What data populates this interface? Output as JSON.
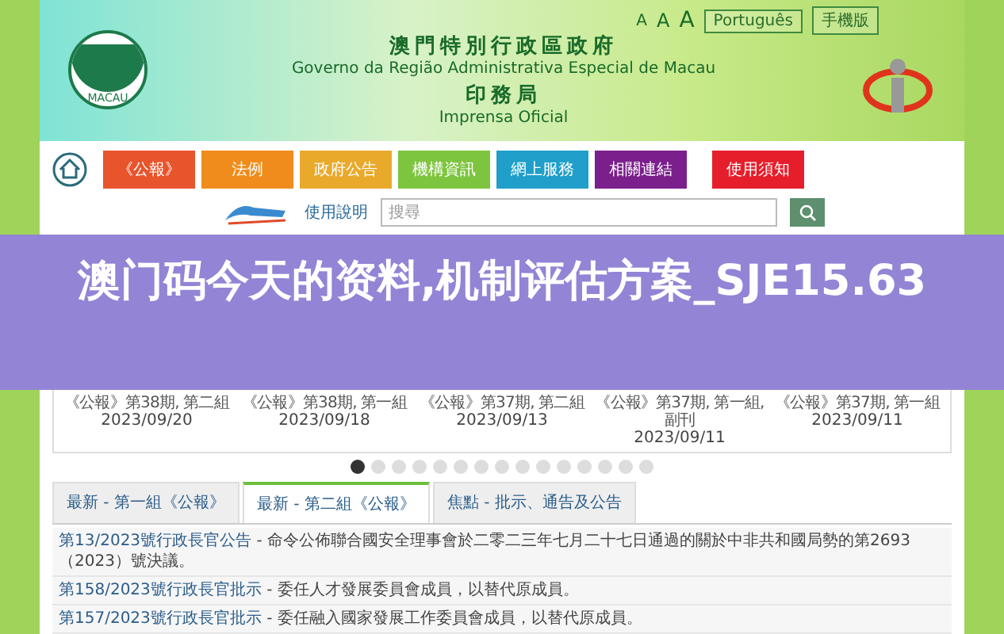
{
  "header": {
    "font_sizes": [
      "A",
      "A",
      "A"
    ],
    "languages": [
      "Português",
      "手機版"
    ],
    "title_zh": "澳門特別行政區政府",
    "title_pt": "Governo da Região Administrativa Especial de Macau",
    "dept_zh": "印務局",
    "dept_pt": "Imprensa Oficial",
    "emblem_text": "MACAU"
  },
  "nav": [
    {
      "label": "《公報》",
      "color": "#e8542c"
    },
    {
      "label": "法例",
      "color": "#f08c1c"
    },
    {
      "label": "政府公告",
      "color": "#e9aa2c"
    },
    {
      "label": "機構資訊",
      "color": "#7dc53e"
    },
    {
      "label": "網上服務",
      "color": "#1f9fc9"
    },
    {
      "label": "相關連結",
      "color": "#7b1f8c"
    },
    {
      "label": "使用須知",
      "color": "#e61e2b"
    }
  ],
  "search": {
    "help": "使用說明",
    "placeholder": "搜尋"
  },
  "banner": {
    "title": "澳门码今天的资料,机制评估方案_SJE15.63"
  },
  "cards": [
    {
      "caption": "《公報》第38期, 第二組",
      "date": "2023/09/20"
    },
    {
      "caption": "《公報》第38期, 第一組",
      "date": "2023/09/18"
    },
    {
      "caption": "《公報》第37期, 第二組",
      "date": "2023/09/13"
    },
    {
      "caption": "《公報》第37期, 第一組, 副刊",
      "date": "2023/09/11"
    },
    {
      "caption": "《公報》第37期, 第一組",
      "date": "2023/09/11"
    }
  ],
  "dots": [
    {
      "selected": true
    },
    {
      "selected": false
    },
    {
      "selected": false
    },
    {
      "selected": false
    },
    {
      "selected": false
    },
    {
      "selected": false
    },
    {
      "selected": false
    },
    {
      "selected": false
    },
    {
      "selected": false
    },
    {
      "selected": false
    },
    {
      "selected": false
    },
    {
      "selected": false
    },
    {
      "selected": false
    },
    {
      "selected": false
    },
    {
      "selected": false
    }
  ],
  "tabs": [
    {
      "label": "最新 - 第一組《公報》",
      "selected": false
    },
    {
      "label": "最新 - 第二組《公報》",
      "selected": true
    },
    {
      "label": "焦點 - 批示、通告及公告",
      "selected": false
    }
  ],
  "rows": [
    {
      "link": "第13/2023號行政長官公告",
      "text": " - 命令公佈聯合國安全理事會於二零二三年七月二十七日通過的關於中非共和國局勢的第2693（2023）號決議。"
    },
    {
      "link": "第158/2023號行政長官批示",
      "text": " - 委任人才發展委員會成員，以替代原成員。"
    },
    {
      "link": "第157/2023號行政長官批示",
      "text": " - 委任融入國家發展工作委員會成員，以替代原成員。"
    }
  ]
}
